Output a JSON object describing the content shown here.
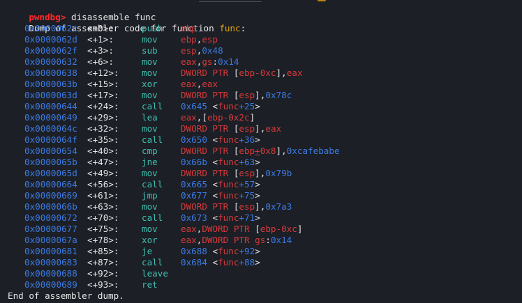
{
  "terminal": {
    "prompt": "pwndbg>",
    "command": "disassemble func",
    "header_prefix": "Dump of assembler code for function ",
    "header_func": "func",
    "header_suffix": ":",
    "footer": "End of assembler dump."
  },
  "instructions": [
    {
      "addr": "0x0000062c",
      "off": "<+0>:",
      "mnem": "push",
      "ops": [
        {
          "t": "ebp",
          "c": "r"
        }
      ]
    },
    {
      "addr": "0x0000062d",
      "off": "<+1>:",
      "mnem": "mov",
      "ops": [
        {
          "t": "ebp",
          "c": "r"
        },
        {
          "t": ",",
          "c": "w"
        },
        {
          "t": "esp",
          "c": "r"
        }
      ]
    },
    {
      "addr": "0x0000062f",
      "off": "<+3>:",
      "mnem": "sub",
      "ops": [
        {
          "t": "esp",
          "c": "r"
        },
        {
          "t": ",",
          "c": "w"
        },
        {
          "t": "0x48",
          "c": "b"
        }
      ]
    },
    {
      "addr": "0x00000632",
      "off": "<+6>:",
      "mnem": "mov",
      "ops": [
        {
          "t": "eax",
          "c": "r"
        },
        {
          "t": ",",
          "c": "w"
        },
        {
          "t": "gs",
          "c": "r"
        },
        {
          "t": ":",
          "c": "w"
        },
        {
          "t": "0x14",
          "c": "b"
        }
      ]
    },
    {
      "addr": "0x00000638",
      "off": "<+12>:",
      "mnem": "mov",
      "ops": [
        {
          "t": "DWORD PTR ",
          "c": "r"
        },
        {
          "t": "[",
          "c": "w"
        },
        {
          "t": "ebp-0xc",
          "c": "r"
        },
        {
          "t": "]",
          "c": "w"
        },
        {
          "t": ",",
          "c": "w"
        },
        {
          "t": "eax",
          "c": "r"
        }
      ]
    },
    {
      "addr": "0x0000063b",
      "off": "<+15>:",
      "mnem": "xor",
      "ops": [
        {
          "t": "eax",
          "c": "r"
        },
        {
          "t": ",",
          "c": "w"
        },
        {
          "t": "eax",
          "c": "r"
        }
      ]
    },
    {
      "addr": "0x0000063d",
      "off": "<+17>:",
      "mnem": "mov",
      "ops": [
        {
          "t": "DWORD PTR ",
          "c": "r"
        },
        {
          "t": "[",
          "c": "w"
        },
        {
          "t": "esp",
          "c": "r"
        },
        {
          "t": "]",
          "c": "w"
        },
        {
          "t": ",",
          "c": "w"
        },
        {
          "t": "0x78c",
          "c": "b"
        }
      ]
    },
    {
      "addr": "0x00000644",
      "off": "<+24>:",
      "mnem": "call",
      "ops": [
        {
          "t": "0x645 ",
          "c": "b"
        },
        {
          "t": "<",
          "c": "w"
        },
        {
          "t": "func",
          "c": "r"
        },
        {
          "t": "+25",
          "c": "b"
        },
        {
          "t": ">",
          "c": "w"
        }
      ]
    },
    {
      "addr": "0x00000649",
      "off": "<+29>:",
      "mnem": "lea",
      "ops": [
        {
          "t": "eax",
          "c": "r"
        },
        {
          "t": ",",
          "c": "w"
        },
        {
          "t": "[",
          "c": "w"
        },
        {
          "t": "ebp-0x2c",
          "c": "r"
        },
        {
          "t": "]",
          "c": "w"
        }
      ]
    },
    {
      "addr": "0x0000064c",
      "off": "<+32>:",
      "mnem": "mov",
      "ops": [
        {
          "t": "DWORD PTR ",
          "c": "r"
        },
        {
          "t": "[",
          "c": "w"
        },
        {
          "t": "esp",
          "c": "r"
        },
        {
          "t": "]",
          "c": "w"
        },
        {
          "t": ",",
          "c": "w"
        },
        {
          "t": "eax",
          "c": "r"
        }
      ]
    },
    {
      "addr": "0x0000064f",
      "off": "<+35>:",
      "mnem": "call",
      "ops": [
        {
          "t": "0x650 ",
          "c": "b"
        },
        {
          "t": "<",
          "c": "w"
        },
        {
          "t": "func",
          "c": "r"
        },
        {
          "t": "+36",
          "c": "b"
        },
        {
          "t": ">",
          "c": "w"
        }
      ]
    },
    {
      "addr": "0x00000654",
      "off": "<+40>:",
      "mnem": "cmp",
      "ops": [
        {
          "t": "DWORD PTR ",
          "c": "r"
        },
        {
          "t": "[",
          "c": "w"
        },
        {
          "t": "ebp",
          "c": "r"
        },
        {
          "t": "+",
          "c": "u"
        },
        {
          "t": "0x8",
          "c": "r"
        },
        {
          "t": "]",
          "c": "w"
        },
        {
          "t": ",",
          "c": "w"
        },
        {
          "t": "0xcafebabe",
          "c": "b"
        }
      ]
    },
    {
      "addr": "0x0000065b",
      "off": "<+47>:",
      "mnem": "jne",
      "ops": [
        {
          "t": "0x66b ",
          "c": "b"
        },
        {
          "t": "<",
          "c": "w"
        },
        {
          "t": "func",
          "c": "r"
        },
        {
          "t": "+63",
          "c": "b"
        },
        {
          "t": ">",
          "c": "w"
        }
      ]
    },
    {
      "addr": "0x0000065d",
      "off": "<+49>:",
      "mnem": "mov",
      "ops": [
        {
          "t": "DWORD PTR ",
          "c": "r"
        },
        {
          "t": "[",
          "c": "w"
        },
        {
          "t": "esp",
          "c": "r"
        },
        {
          "t": "]",
          "c": "w"
        },
        {
          "t": ",",
          "c": "w"
        },
        {
          "t": "0x79b",
          "c": "b"
        }
      ]
    },
    {
      "addr": "0x00000664",
      "off": "<+56>:",
      "mnem": "call",
      "ops": [
        {
          "t": "0x665 ",
          "c": "b"
        },
        {
          "t": "<",
          "c": "w"
        },
        {
          "t": "func",
          "c": "r"
        },
        {
          "t": "+57",
          "c": "b"
        },
        {
          "t": ">",
          "c": "w"
        }
      ]
    },
    {
      "addr": "0x00000669",
      "off": "<+61>:",
      "mnem": "jmp",
      "ops": [
        {
          "t": "0x677 ",
          "c": "b"
        },
        {
          "t": "<",
          "c": "w"
        },
        {
          "t": "func",
          "c": "r"
        },
        {
          "t": "+75",
          "c": "b"
        },
        {
          "t": ">",
          "c": "w"
        }
      ]
    },
    {
      "addr": "0x0000066b",
      "off": "<+63>:",
      "mnem": "mov",
      "ops": [
        {
          "t": "DWORD PTR ",
          "c": "r"
        },
        {
          "t": "[",
          "c": "w"
        },
        {
          "t": "esp",
          "c": "r"
        },
        {
          "t": "]",
          "c": "w"
        },
        {
          "t": ",",
          "c": "w"
        },
        {
          "t": "0x7a3",
          "c": "b"
        }
      ]
    },
    {
      "addr": "0x00000672",
      "off": "<+70>:",
      "mnem": "call",
      "ops": [
        {
          "t": "0x673 ",
          "c": "b"
        },
        {
          "t": "<",
          "c": "w"
        },
        {
          "t": "func",
          "c": "r"
        },
        {
          "t": "+71",
          "c": "b"
        },
        {
          "t": ">",
          "c": "w"
        }
      ]
    },
    {
      "addr": "0x00000677",
      "off": "<+75>:",
      "mnem": "mov",
      "ops": [
        {
          "t": "eax",
          "c": "r"
        },
        {
          "t": ",",
          "c": "w"
        },
        {
          "t": "DWORD PTR ",
          "c": "r"
        },
        {
          "t": "[",
          "c": "w"
        },
        {
          "t": "ebp-0xc",
          "c": "r"
        },
        {
          "t": "]",
          "c": "w"
        }
      ]
    },
    {
      "addr": "0x0000067a",
      "off": "<+78>:",
      "mnem": "xor",
      "ops": [
        {
          "t": "eax",
          "c": "r"
        },
        {
          "t": ",",
          "c": "w"
        },
        {
          "t": "DWORD PTR ",
          "c": "r"
        },
        {
          "t": "gs",
          "c": "r"
        },
        {
          "t": ":",
          "c": "w"
        },
        {
          "t": "0x14",
          "c": "b"
        }
      ]
    },
    {
      "addr": "0x00000681",
      "off": "<+85>:",
      "mnem": "je",
      "ops": [
        {
          "t": "0x688 ",
          "c": "b"
        },
        {
          "t": "<",
          "c": "w"
        },
        {
          "t": "func",
          "c": "r"
        },
        {
          "t": "+92",
          "c": "b"
        },
        {
          "t": ">",
          "c": "w"
        }
      ]
    },
    {
      "addr": "0x00000683",
      "off": "<+87>:",
      "mnem": "call",
      "ops": [
        {
          "t": "0x684 ",
          "c": "b"
        },
        {
          "t": "<",
          "c": "w"
        },
        {
          "t": "func",
          "c": "r"
        },
        {
          "t": "+88",
          "c": "b"
        },
        {
          "t": ">",
          "c": "w"
        }
      ]
    },
    {
      "addr": "0x00000688",
      "off": "<+92>:",
      "mnem": "leave",
      "ops": []
    },
    {
      "addr": "0x00000689",
      "off": "<+93>:",
      "mnem": "ret",
      "ops": []
    }
  ],
  "colors": {
    "background": "#1c1f26",
    "prompt": "#ff2a2a",
    "address": "#3c7be2",
    "mnemonic": "#3fbfb0",
    "register": "#d83a3a",
    "immediate": "#3c7be2",
    "function_name": "#e5a50a"
  }
}
